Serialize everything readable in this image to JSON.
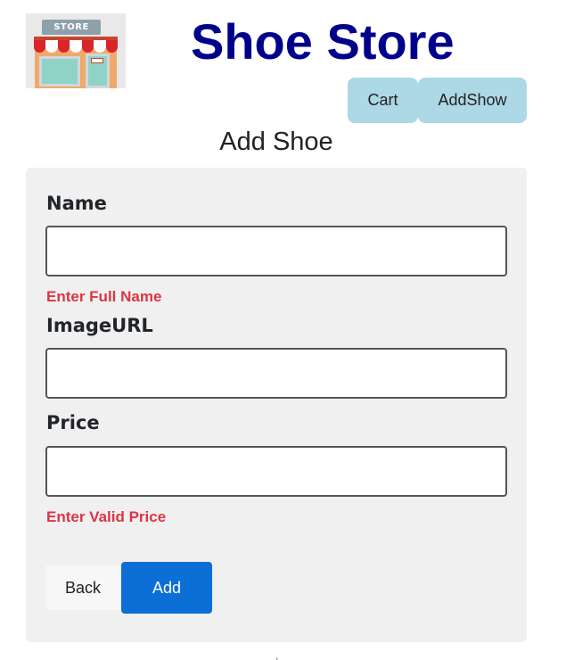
{
  "header": {
    "logo_text": "STORE",
    "title": "Shoe Store",
    "title_color": "#00008b",
    "nav": {
      "cart_label": "Cart",
      "addshow_label": "AddShow",
      "button_color": "#add8e6"
    }
  },
  "page": {
    "title": "Add Shoe"
  },
  "form": {
    "fields": [
      {
        "label": "Name",
        "value": "",
        "placeholder": "",
        "error": "Enter Full Name"
      },
      {
        "label": "ImageURL",
        "value": "",
        "placeholder": "",
        "error": ""
      },
      {
        "label": "Price",
        "value": "",
        "placeholder": "",
        "error": "Enter Valid Price"
      }
    ],
    "error_color": "#dc3545",
    "back_label": "Back",
    "add_label": "Add",
    "add_color": "#0b6fd6"
  },
  "footer": {
    "mark": ","
  }
}
